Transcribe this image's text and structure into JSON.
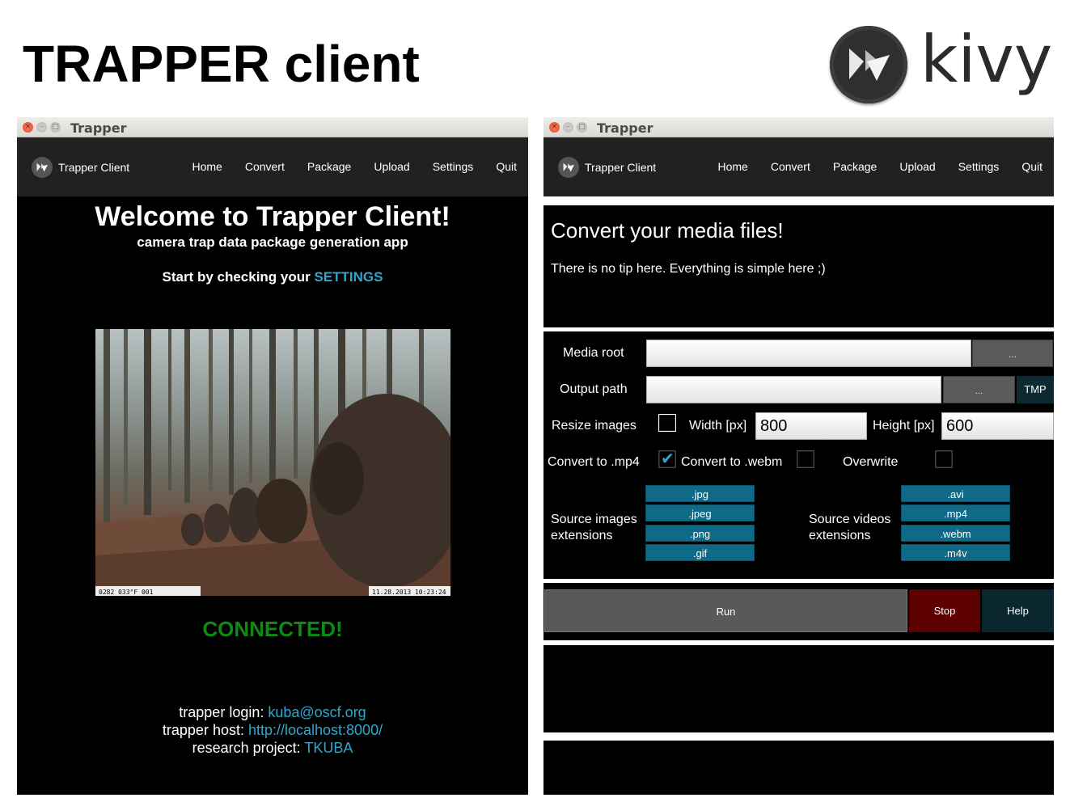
{
  "slide": {
    "title": "TRAPPER client",
    "logo_text": "kivy"
  },
  "left_window": {
    "title": "Trapper",
    "nav": {
      "brand": "Trapper Client",
      "items": [
        "Home",
        "Convert",
        "Package",
        "Upload",
        "Settings",
        "Quit"
      ]
    },
    "welcome": "Welcome to Trapper Client!",
    "subtitle": "camera trap data package generation app",
    "start_prefix": "Start by checking your ",
    "start_link": "SETTINGS",
    "photo_stamp_left": "0282      033°F  001",
    "photo_stamp_right": "11.28.2013 10:23:24",
    "status": "CONNECTED!",
    "info": {
      "login_label": "trapper login: ",
      "login_value": "kuba@oscf.org",
      "host_label": "trapper host: ",
      "host_value": "http://localhost:8000/",
      "project_label": "research project: ",
      "project_value": "TKUBA"
    }
  },
  "right_window": {
    "title": "Trapper",
    "nav": {
      "brand": "Trapper Client",
      "items": [
        "Home",
        "Convert",
        "Package",
        "Upload",
        "Settings",
        "Quit"
      ]
    },
    "convert_title": "Convert your media files!",
    "convert_tip": "There is no tip here. Everything is simple here ;)",
    "form": {
      "media_root_label": "Media root",
      "media_root_value": "",
      "browse_label": "...",
      "output_path_label": "Output path",
      "output_path_value": "",
      "tmp_label": "TMP",
      "resize_label": "Resize images",
      "resize_checked": false,
      "width_label": "Width [px]",
      "width_value": "800",
      "height_label": "Height [px]",
      "height_value": "600",
      "mp4_label": "Convert to .mp4",
      "mp4_checked": true,
      "webm_label": "Convert to .webm",
      "webm_checked": false,
      "overwrite_label": "Overwrite",
      "overwrite_checked": false,
      "source_images_label_1": "Source images",
      "source_images_label_2": "extensions",
      "image_exts": [
        ".jpg",
        ".jpeg",
        ".png",
        ".gif"
      ],
      "source_videos_label_1": "Source videos",
      "source_videos_label_2": "extensions",
      "video_exts": [
        ".avi",
        ".mp4",
        ".webm",
        ".m4v"
      ]
    },
    "actions": {
      "run": "Run",
      "stop": "Stop",
      "help": "Help"
    }
  },
  "colors": {
    "link": "#33a6cc",
    "connected": "#0f8a14",
    "ext_button": "#0e6a86",
    "stop_button": "#5c0000",
    "help_button": "#0a2730"
  }
}
